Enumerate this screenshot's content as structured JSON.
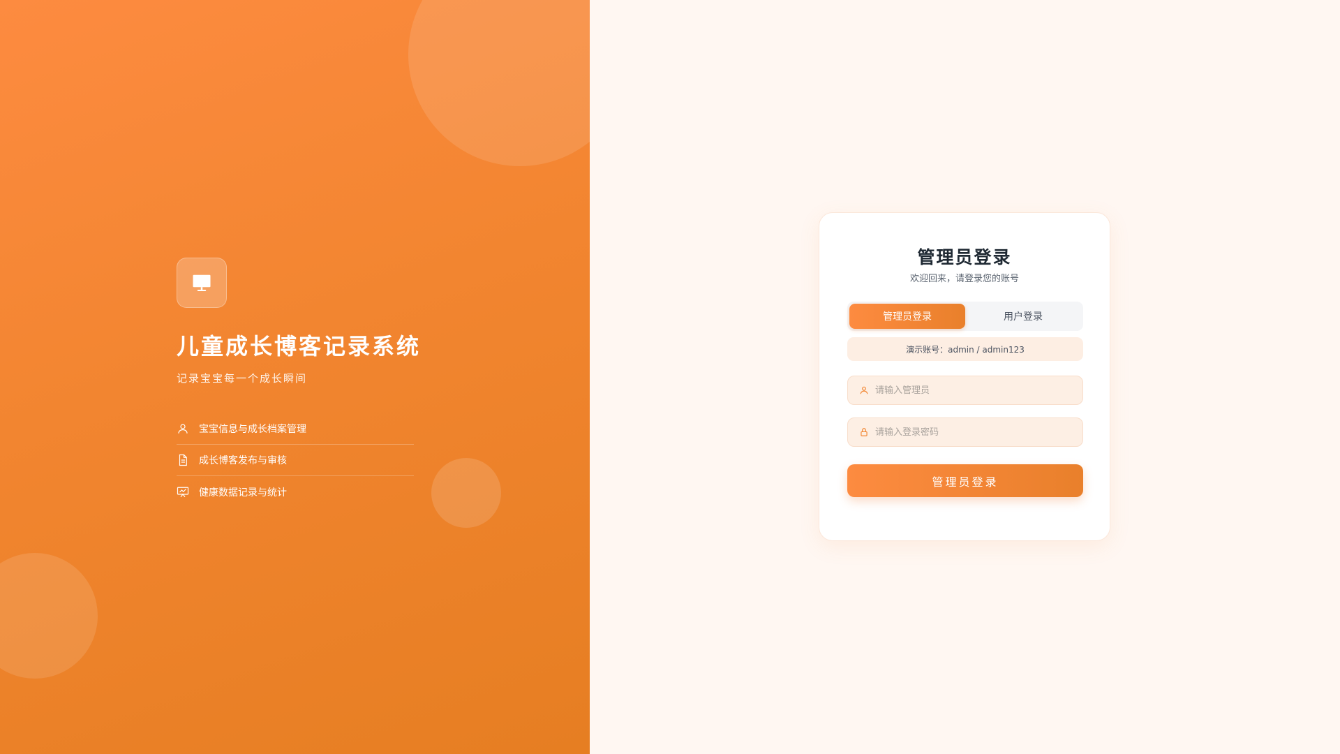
{
  "brand": {
    "logo_icon": "monitor-icon",
    "title": "儿童成长博客记录系统",
    "subtitle": "记录宝宝每一个成长瞬间",
    "features": [
      {
        "icon": "user-icon",
        "label": "宝宝信息与成长档案管理"
      },
      {
        "icon": "document-icon",
        "label": "成长博客发布与审核"
      },
      {
        "icon": "chart-board-icon",
        "label": "健康数据记录与统计"
      }
    ]
  },
  "login": {
    "title": "管理员登录",
    "subtitle": "欢迎回来，请登录您的账号",
    "tabs": [
      {
        "label": "管理员登录",
        "active": true
      },
      {
        "label": "用户登录",
        "active": false
      }
    ],
    "demo_hint": "演示账号：admin / admin123",
    "username": {
      "value": "",
      "placeholder": "请输入管理员",
      "icon": "user-icon"
    },
    "password": {
      "value": "",
      "placeholder": "请输入登录密码",
      "icon": "lock-icon"
    },
    "submit_label": "管理员登录"
  },
  "colors": {
    "accent": "#f28530",
    "accent_dark": "#e67e22",
    "right_bg": "#fff7f2"
  }
}
